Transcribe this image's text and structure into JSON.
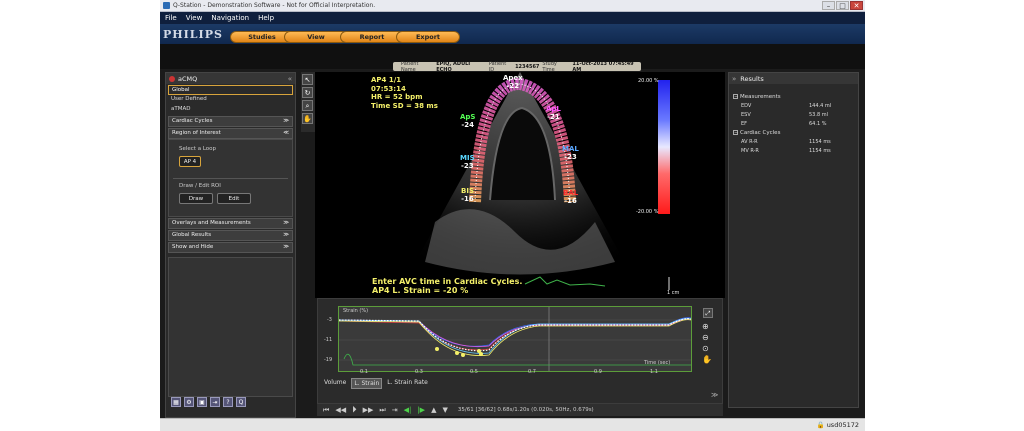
{
  "window": {
    "title": "Q-Station - Demonstration Software - Not for Official Interpretation."
  },
  "menu": [
    "File",
    "View",
    "Navigation",
    "Help"
  ],
  "brand": "PHILIPS",
  "tabs": [
    "Studies",
    "View",
    "Report",
    "Export"
  ],
  "patient": {
    "name_label": "Patient Name",
    "name": "EPIQ, ADULT ECHO",
    "id_label": "Patient ID",
    "id": "1234567",
    "time_label": "Study Time",
    "time": "11-Oct-2013 07:45:49 AM"
  },
  "left_panel": {
    "title": "aCMQ",
    "presets": [
      "Global",
      "User Defined",
      "aTMAD"
    ],
    "sections": {
      "cardiac_cycles": "Cardiac Cycles",
      "roi": "Region of Interest",
      "overlays": "Overlays and Measurements",
      "global_results": "Global Results",
      "show_hide": "Show and Hide"
    },
    "select_loop_label": "Select a Loop",
    "loop_button": "AP 4",
    "draw_edit_label": "Draw / Edit ROI",
    "draw_button": "Draw",
    "edit_button": "Edit"
  },
  "viewer": {
    "info": [
      "AP4  1/1",
      "07:53:14",
      "HR = 52 bpm",
      "Time SD = 38 ms"
    ],
    "segments": [
      {
        "name": "Apex",
        "value": "-22",
        "color": "#ffffff"
      },
      {
        "name": "ApL",
        "value": "-21",
        "color": "#ff55ff"
      },
      {
        "name": "ApS",
        "value": "-24",
        "color": "#55ff55"
      },
      {
        "name": "MAL",
        "value": "-23",
        "color": "#5aa8ff"
      },
      {
        "name": "MIS",
        "value": "-23",
        "color": "#5ad8ff"
      },
      {
        "name": "BIS",
        "value": "-16",
        "color": "#f4f06a"
      },
      {
        "name": "BAL",
        "value": "-16",
        "color": "#ff3030"
      }
    ],
    "message": [
      "Enter AVC time in Cardiac Cycles.",
      "AP4 L. Strain = -20 %"
    ],
    "colorbar": {
      "top": "20.00 %",
      "bottom": "-20.00 %"
    },
    "scale_label": "1 cm"
  },
  "curve": {
    "ylabel": "Strain (%)",
    "yticks": [
      "-3",
      "-11",
      "-19"
    ],
    "xticks": [
      "0.1",
      "0.3",
      "0.5",
      "0.7",
      "0.9",
      "1.1"
    ],
    "xlabel": "Time (sec)",
    "tabs": [
      "Volume",
      "L. Strain",
      "L. Strain Rate"
    ]
  },
  "playback": {
    "info": "35/61  [36/62] 0.68s/1.20s  (0.020s, 50Hz, 0.679s)"
  },
  "results": {
    "title": "Results",
    "measurements_label": "Measurements",
    "measurements": [
      {
        "name": "EDV",
        "value": "144.4 ml"
      },
      {
        "name": "ESV",
        "value": "53.8 ml"
      },
      {
        "name": "EF",
        "value": "64.1 %"
      }
    ],
    "cycles_label": "Cardiac Cycles",
    "cycles": [
      {
        "name": "AV R-R",
        "value": "1154 ms"
      },
      {
        "name": "MV R-R",
        "value": "1154 ms"
      }
    ]
  },
  "status": {
    "user": "usd05172"
  }
}
